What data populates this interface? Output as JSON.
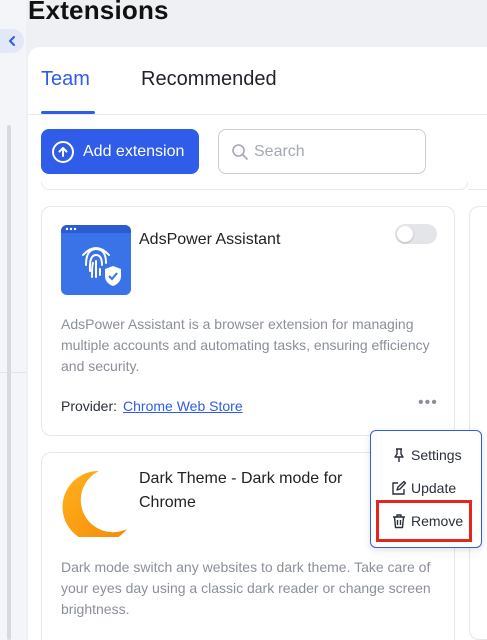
{
  "page": {
    "title": "Extensions"
  },
  "tabs": [
    {
      "label": "Team",
      "active": true
    },
    {
      "label": "Recommended",
      "active": false
    }
  ],
  "toolbar": {
    "add_label": "Add extension",
    "search_placeholder": "Search"
  },
  "extensions": [
    {
      "name": "AdsPower Assistant",
      "enabled": false,
      "description": "AdsPower Assistant is a browser extension for managing multiple accounts and automating tasks, ensuring efficiency and security.",
      "provider_label": "Provider:",
      "provider_link": "Chrome Web Store",
      "icon": "fingerprint-shield-icon"
    },
    {
      "name": "Dark Theme - Dark mode for Chrome",
      "description": "Dark mode switch any websites to dark theme. Take care of your eyes day using a classic dark reader or change screen brightness.",
      "icon": "crescent-moon-icon"
    }
  ],
  "context_menu": {
    "items": [
      {
        "label": "Settings",
        "icon": "pin-icon"
      },
      {
        "label": "Update",
        "icon": "edit-icon"
      },
      {
        "label": "Remove",
        "icon": "trash-icon",
        "highlighted": true
      }
    ]
  },
  "colors": {
    "accent": "#2f5ce8",
    "highlight": "#e5261f"
  }
}
